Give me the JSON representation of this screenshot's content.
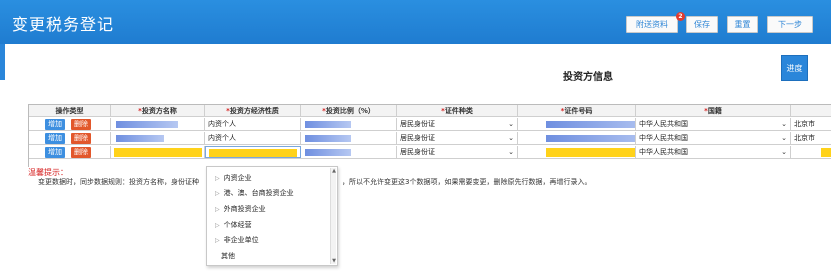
{
  "app": {
    "title": "变更税务登记"
  },
  "toolbar": {
    "send_label": "附送资料",
    "send_badge": "2",
    "save_label": "保存",
    "reset_label": "重置",
    "next_label": "下一步"
  },
  "progress_label": "进度",
  "section_title": "投资方信息",
  "table": {
    "headers": {
      "op": "操作类型",
      "name": "投资方名称",
      "econ": "投资方经济性质",
      "ratio": "投资比例（%）",
      "idtype": "证件种类",
      "idno": "证件号码",
      "country": "国籍"
    },
    "add_label": "增加",
    "del_label": "删除",
    "rows": [
      {
        "econ": "内资个人",
        "idtype": "居民身份证",
        "country": "中华人民共和国",
        "extra": "北京市"
      },
      {
        "econ": "内资个人",
        "idtype": "居民身份证",
        "country": "中华人民共和国",
        "extra": "北京市"
      },
      {
        "econ": "",
        "idtype": "居民身份证",
        "country": "中华人民共和国",
        "extra": ""
      }
    ]
  },
  "tips": {
    "label": "温馨提示：",
    "text1": "变更数据时，同步数据规则：投资方名称，身份证种",
    "text2": "，所以不允许变更这3个数据项，如果需要变更，删除原先行数据，再增行录入。"
  },
  "dropdown": {
    "items": [
      {
        "label": "内资企业",
        "arrow": "▷"
      },
      {
        "label": "港、澳、台商投资企业",
        "arrow": "▷"
      },
      {
        "label": "外商投资企业",
        "arrow": "▷"
      },
      {
        "label": "个体经营",
        "arrow": "▷"
      },
      {
        "label": "非企业单位",
        "arrow": "▷"
      },
      {
        "label": "其他",
        "arrow": ""
      }
    ]
  },
  "colors": {
    "header_bg": "#1f7cd0",
    "highlight": "#ffd21a",
    "add_btn": "#3d8fe0",
    "del_btn": "#e2572b",
    "required": "#d62020"
  }
}
